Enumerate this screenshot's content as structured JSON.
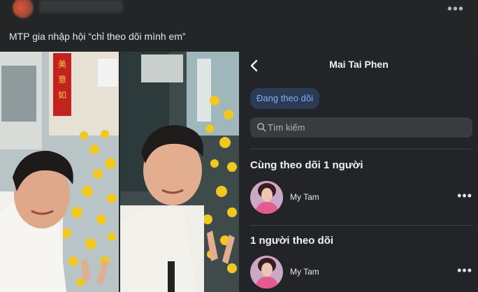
{
  "post": {
    "caption": "MTP gia nhập hội “chỉ theo dõi mình em”",
    "more_icon": "•••"
  },
  "profile_panel": {
    "title": "Mai Tai Phen",
    "following_button": "Đang theo dõi",
    "search_placeholder": "Tìm kiếm",
    "mutual_section_title": "Cùng theo dõi 1 người",
    "followers_section_title": "1 người theo dõi",
    "mutual_users": [
      {
        "name": "My Tam",
        "more": "•••"
      }
    ],
    "followers": [
      {
        "name": "My Tam",
        "more": "•••"
      }
    ]
  },
  "colors": {
    "background": "#242526",
    "panel_background": "#232428",
    "accent_button_bg": "#2b3b55",
    "accent_button_text": "#7fb0f5"
  }
}
